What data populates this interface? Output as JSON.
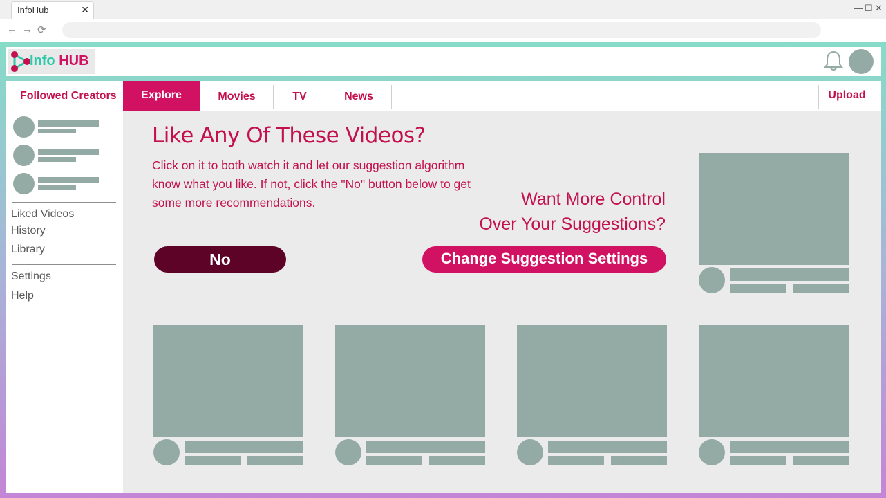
{
  "browser": {
    "tab_title": "InfoHub",
    "tab_close": "✕",
    "back": "←",
    "forward": "→",
    "reload": "⟳",
    "minimize": "—",
    "maximize": "☐",
    "close": "✕"
  },
  "brand": {
    "info": "Info",
    "hub": "HUB"
  },
  "nav": {
    "followed_creators": "Followed Creators",
    "tabs": [
      "Explore",
      "Movies",
      "TV",
      "News"
    ],
    "active_tab": "Explore",
    "upload": "Upload"
  },
  "sidebar": {
    "links_group1": [
      "Liked Videos",
      "History",
      "Library"
    ],
    "links_group2": [
      "Settings",
      "Help"
    ]
  },
  "main": {
    "headline": "Like Any Of These Videos?",
    "subtext": "Click on it to both watch it and let our suggestion algorithm know what you like. If not, click the \"No\" button below to get some more recommendations.",
    "control_line1": "Want More Control",
    "control_line2": "Over Your Suggestions?",
    "no_button": "No",
    "change_button": "Change Suggestion Settings"
  },
  "colors": {
    "accent": "#d11162",
    "accent_text": "#c3104f",
    "dark_button": "#5d0327",
    "placeholder": "#94aba5",
    "teal": "#2cc9a8"
  }
}
